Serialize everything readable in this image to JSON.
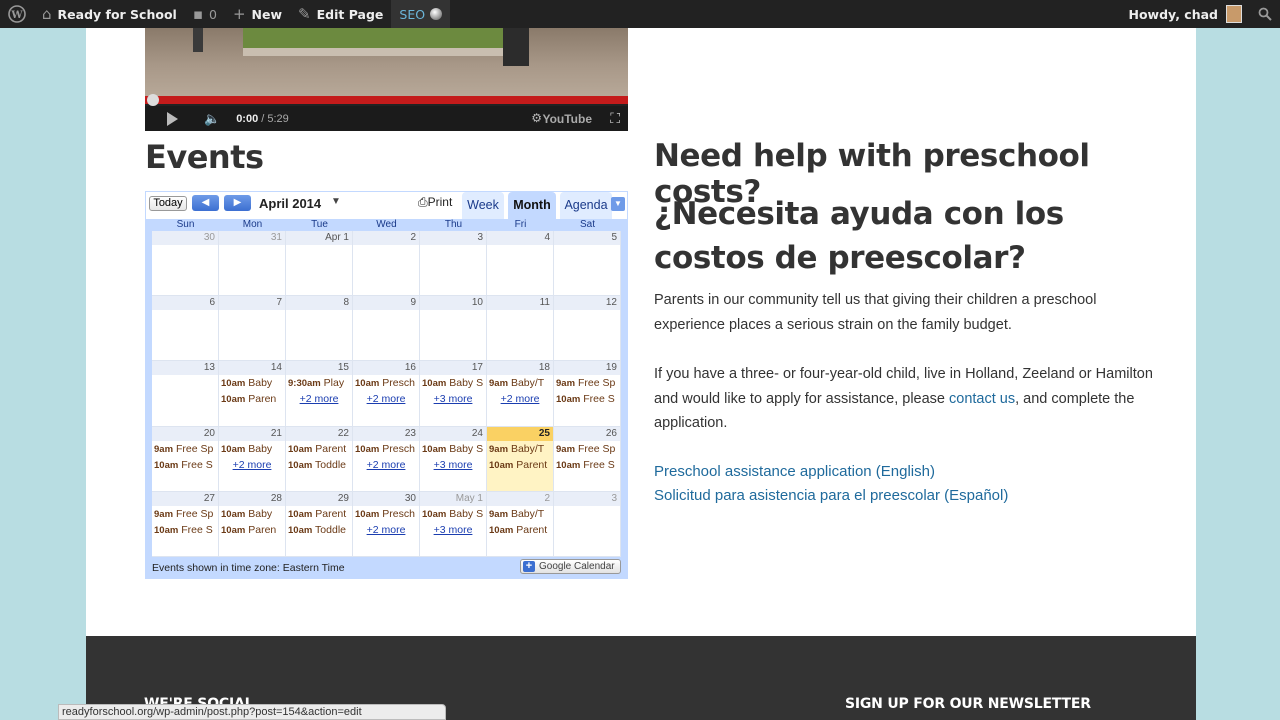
{
  "adminbar": {
    "site_name": "Ready for School",
    "comments_count": "0",
    "new_label": "New",
    "edit_label": "Edit Page",
    "seo_label": "SEO",
    "greeting": "Howdy, chad"
  },
  "video": {
    "current_time": "0:00",
    "duration": "/ 5:29",
    "logo_text": "YouTube",
    "progress": 0
  },
  "events": {
    "title": "Events"
  },
  "calendar": {
    "today_label": "Today",
    "prev_label": "◀",
    "next_label": "▶",
    "month_label": "April 2014",
    "print_label": "Print",
    "tabs": [
      "Week",
      "Month",
      "Agenda"
    ],
    "active_tab": "Month",
    "weekdays": [
      "Sun",
      "Mon",
      "Tue",
      "Wed",
      "Thu",
      "Fri",
      "Sat"
    ],
    "weeks": [
      [
        {
          "day": "30",
          "other": true,
          "events": [],
          "more": ""
        },
        {
          "day": "31",
          "other": true,
          "events": [],
          "more": ""
        },
        {
          "day": "Apr 1",
          "events": [],
          "more": ""
        },
        {
          "day": "2",
          "events": [],
          "more": ""
        },
        {
          "day": "3",
          "events": [],
          "more": ""
        },
        {
          "day": "4",
          "events": [],
          "more": ""
        },
        {
          "day": "5",
          "events": [],
          "more": ""
        }
      ],
      [
        {
          "day": "6",
          "events": [],
          "more": ""
        },
        {
          "day": "7",
          "events": [],
          "more": ""
        },
        {
          "day": "8",
          "events": [],
          "more": ""
        },
        {
          "day": "9",
          "events": [],
          "more": ""
        },
        {
          "day": "10",
          "events": [],
          "more": ""
        },
        {
          "day": "11",
          "events": [],
          "more": ""
        },
        {
          "day": "12",
          "events": [],
          "more": ""
        }
      ],
      [
        {
          "day": "13",
          "events": [],
          "more": ""
        },
        {
          "day": "14",
          "events": [
            {
              "time": "10am",
              "title": "Baby"
            },
            {
              "time": "10am",
              "title": "Paren"
            }
          ],
          "more": ""
        },
        {
          "day": "15",
          "events": [
            {
              "time": "9:30am",
              "title": "Play"
            }
          ],
          "more": "+2 more"
        },
        {
          "day": "16",
          "events": [
            {
              "time": "10am",
              "title": "Presch"
            }
          ],
          "more": "+2 more"
        },
        {
          "day": "17",
          "events": [
            {
              "time": "10am",
              "title": "Baby S"
            }
          ],
          "more": "+3 more"
        },
        {
          "day": "18",
          "events": [
            {
              "time": "9am",
              "title": "Baby/T"
            }
          ],
          "more": "+2 more"
        },
        {
          "day": "19",
          "events": [
            {
              "time": "9am",
              "title": "Free Sp"
            },
            {
              "time": "10am",
              "title": "Free S"
            }
          ],
          "more": ""
        }
      ],
      [
        {
          "day": "20",
          "events": [
            {
              "time": "9am",
              "title": "Free Sp"
            },
            {
              "time": "10am",
              "title": "Free S"
            }
          ],
          "more": ""
        },
        {
          "day": "21",
          "events": [
            {
              "time": "10am",
              "title": "Baby"
            }
          ],
          "more": "+2 more"
        },
        {
          "day": "22",
          "events": [
            {
              "time": "10am",
              "title": "Parent"
            },
            {
              "time": "10am",
              "title": "Toddle"
            }
          ],
          "more": ""
        },
        {
          "day": "23",
          "events": [
            {
              "time": "10am",
              "title": "Presch"
            }
          ],
          "more": "+2 more"
        },
        {
          "day": "24",
          "events": [
            {
              "time": "10am",
              "title": "Baby S"
            }
          ],
          "more": "+3 more"
        },
        {
          "day": "25",
          "today": true,
          "events": [
            {
              "time": "9am",
              "title": "Baby/T"
            },
            {
              "time": "10am",
              "title": "Parent"
            }
          ],
          "more": ""
        },
        {
          "day": "26",
          "events": [
            {
              "time": "9am",
              "title": "Free Sp"
            },
            {
              "time": "10am",
              "title": "Free S"
            }
          ],
          "more": ""
        }
      ],
      [
        {
          "day": "27",
          "events": [
            {
              "time": "9am",
              "title": "Free Sp"
            },
            {
              "time": "10am",
              "title": "Free S"
            }
          ],
          "more": ""
        },
        {
          "day": "28",
          "events": [
            {
              "time": "10am",
              "title": "Baby"
            },
            {
              "time": "10am",
              "title": "Paren"
            }
          ],
          "more": ""
        },
        {
          "day": "29",
          "events": [
            {
              "time": "10am",
              "title": "Parent"
            },
            {
              "time": "10am",
              "title": "Toddle"
            }
          ],
          "more": ""
        },
        {
          "day": "30",
          "events": [
            {
              "time": "10am",
              "title": "Presch"
            }
          ],
          "more": "+2 more"
        },
        {
          "day": "May 1",
          "other": true,
          "events": [
            {
              "time": "10am",
              "title": "Baby S"
            }
          ],
          "more": "+3 more"
        },
        {
          "day": "2",
          "other": true,
          "events": [
            {
              "time": "9am",
              "title": "Baby/T"
            },
            {
              "time": "10am",
              "title": "Parent"
            }
          ],
          "more": ""
        },
        {
          "day": "3",
          "other": true,
          "events": [],
          "more": ""
        }
      ]
    ],
    "timezone_note": "Events shown in time zone: Eastern Time",
    "gcal_label": "Google Calendar"
  },
  "help": {
    "title_en": "Need help with preschool costs?",
    "title_es": "¿Necesita ayuda con los costos de preescolar?",
    "para1": "Parents in our community tell us that giving their children a preschool experience places a serious strain on the family budget.",
    "para2_before": "If you have a three- or four-year-old child, live in Holland, Zeeland or Hamilton and would like to apply for assistance, please ",
    "para2_link": "contact us",
    "para2_after": ", and complete the application.",
    "link_en": "Preschool assistance application (English)",
    "link_es": "Solicitud para asistencia para el preescolar (Español)"
  },
  "footer": {
    "social_heading": "WE'RE SOCIAL",
    "newsletter_heading": "SIGN UP FOR OUR NEWSLETTER"
  },
  "statusbar": {
    "url": "readyforschool.org/wp-admin/post.php?post=154&action=edit"
  }
}
